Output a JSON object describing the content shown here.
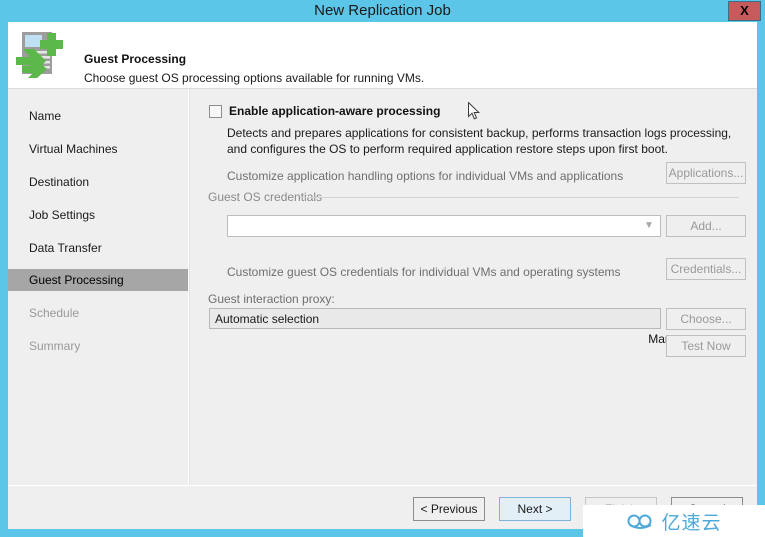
{
  "window": {
    "title": "New Replication Job",
    "close_label": "X",
    "accent_color": "#5cc6e8",
    "close_color": "#c75b5b"
  },
  "header": {
    "icon": "replication-job-icon",
    "title": "Guest Processing",
    "subtitle": "Choose guest OS processing options available for running VMs."
  },
  "sidebar": {
    "items": [
      {
        "label": "Name",
        "state": "normal"
      },
      {
        "label": "Virtual Machines",
        "state": "normal"
      },
      {
        "label": "Destination",
        "state": "normal"
      },
      {
        "label": "Job Settings",
        "state": "normal"
      },
      {
        "label": "Data Transfer",
        "state": "normal"
      },
      {
        "label": "Guest Processing",
        "state": "active"
      },
      {
        "label": "Schedule",
        "state": "disabled"
      },
      {
        "label": "Summary",
        "state": "disabled"
      }
    ]
  },
  "content": {
    "app_aware": {
      "checkbox_label": "Enable application-aware processing",
      "checked": false,
      "description": "Detects and prepares applications for consistent backup, performs transaction logs processing, and configures the OS to perform required application restore steps upon first boot.",
      "customize_text": "Customize application handling options for individual VMs and applications",
      "applications_button": "Applications..."
    },
    "guest_os_credentials": {
      "group_label": "Guest OS credentials",
      "credentials_value": "",
      "credentials_placeholder": "",
      "add_button": "Add...",
      "manage_accounts_link": "Manage accounts",
      "customize_text": "Customize guest OS credentials for individual VMs and operating systems",
      "credentials_button": "Credentials..."
    },
    "guest_interaction_proxy": {
      "label": "Guest interaction proxy:",
      "value": "Automatic selection",
      "choose_button": "Choose...",
      "test_now_button": "Test Now"
    }
  },
  "footer": {
    "previous_button": "< Previous",
    "next_button": "Next >",
    "finish_button": "Finish",
    "cancel_button": "Cancel"
  },
  "watermark": {
    "text": "亿速云",
    "mark": "cloud-logo-icon",
    "color": "#4fa8d8"
  }
}
